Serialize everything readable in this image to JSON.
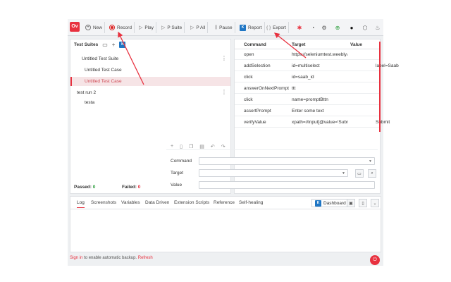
{
  "toolbar": {
    "logo_text": "Ov",
    "new_label": "New",
    "record_label": "Record",
    "play_label": "Play",
    "play_suite_label": "P Suite",
    "play_all_label": "P All",
    "pause_label": "Pause",
    "report_label": "Report",
    "export_label": "Export"
  },
  "left": {
    "title": "Test Suites",
    "suites": [
      {
        "name": "Untitled Test Suite",
        "cases": [
          "Untitled Test Case",
          "Untitled Test Case"
        ]
      },
      {
        "name": "test run 2",
        "cases": [
          "testa"
        ]
      }
    ],
    "passed_label": "Passed:",
    "passed_value": "0",
    "failed_label": "Failed:",
    "failed_value": "0"
  },
  "table": {
    "headers": [
      "Command",
      "Target",
      "Value"
    ],
    "rows": [
      [
        "open",
        "https://seleniumtest.weebly.com/",
        ""
      ],
      [
        "addSelection",
        "id=multiselect",
        "label=Saab"
      ],
      [
        "click",
        "id=saab_id",
        ""
      ],
      [
        "answerOnNextPrompt",
        "ttt",
        ""
      ],
      [
        "click",
        "name=promptBttn",
        ""
      ],
      [
        "assertPrompt",
        "Enter some text",
        ""
      ],
      [
        "verifyValue",
        "xpath=//input[@value='Submit']",
        "Submit"
      ]
    ]
  },
  "editor": {
    "command_label": "Command",
    "target_label": "Target",
    "value_label": "Value"
  },
  "bottom": {
    "tabs": [
      "Log",
      "Screenshots",
      "Variables",
      "Data Driven",
      "Extension Scripts",
      "Reference",
      "Self-healing"
    ],
    "dashboard_label": "Dashboard"
  },
  "footer": {
    "signin": "Sign in",
    "middle": " to enable automatic backup. ",
    "refresh": "Refresh"
  },
  "colors": {
    "accent": "#e8313f",
    "badge": "#1f76c4"
  }
}
